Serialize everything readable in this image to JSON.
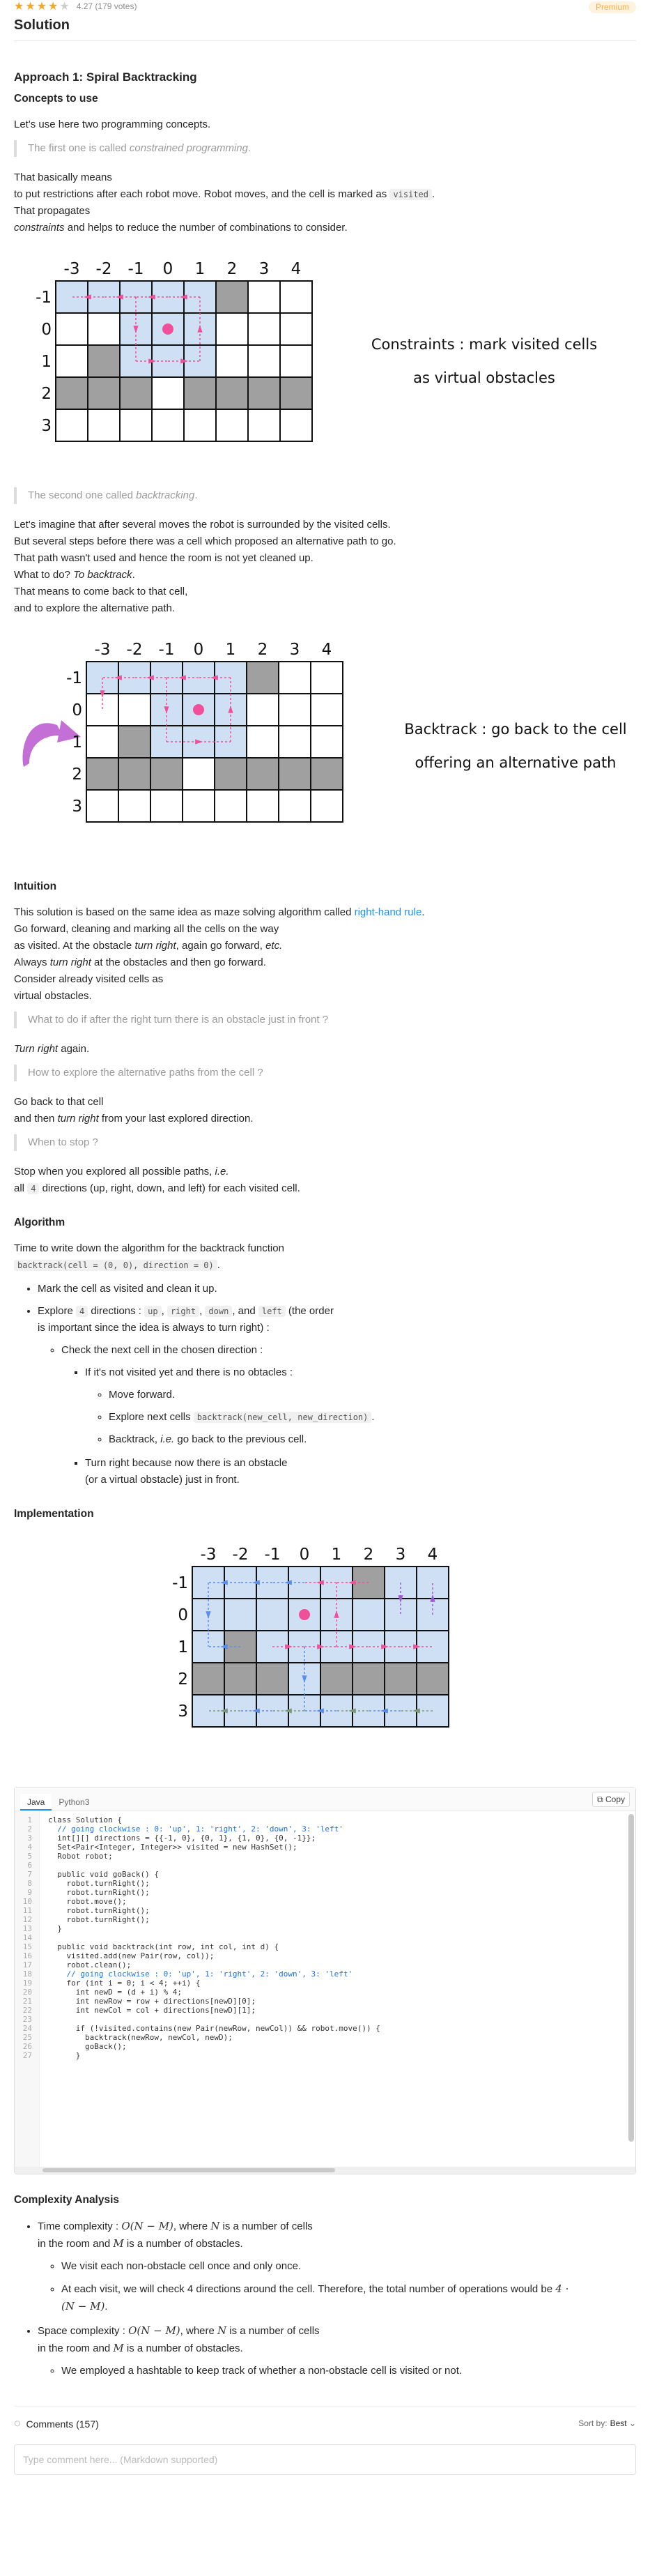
{
  "header": {
    "stars_filled": 4,
    "stars_total": 5,
    "rating_text": "4.27 (179 votes)",
    "premium_label": "Premium",
    "title": "Solution"
  },
  "approach": {
    "title": "Approach 1: Spiral Backtracking",
    "concepts_heading": "Concepts to use",
    "intro": "Let's use here two programming concepts.",
    "quote1_prefix": "The first one is called ",
    "quote1_em": "constrained programming",
    "quote1_suffix": ".",
    "p1_line1": "That basically means",
    "p1_line2_prefix": "to put restrictions after each robot move. Robot moves, and the cell is marked as ",
    "p1_code": "visited",
    "p1_line2_suffix": ".",
    "p1_line3": "That propagates",
    "p1_line4_em": "constraints",
    "p1_line4_suffix": " and helps to reduce the number of combinations to consider.",
    "fig1_caption_line1": "Constraints : mark visited cells",
    "fig1_caption_line2": "as virtual obstacles",
    "quote2_prefix": "The second one called ",
    "quote2_em": "backtracking",
    "quote2_suffix": ".",
    "p2_line1": "Let's imagine that after several moves the robot is surrounded by the visited cells.",
    "p2_line2": "But several steps before there was a cell which proposed an alternative path to go.",
    "p2_line3": "That path wasn't used and hence the room is not yet cleaned up.",
    "p2_line4_prefix": "What to do? ",
    "p2_line4_em": "To backtrack",
    "p2_line4_suffix": ".",
    "p2_line5": "That means to come back to that cell,",
    "p2_line6": "and to explore the alternative path.",
    "fig2_caption_line1": "Backtrack : go back to the cell",
    "fig2_caption_line2": "offering an alternative path"
  },
  "grid": {
    "col_labels": [
      "-3",
      "-2",
      "-1",
      "0",
      "1",
      "2",
      "3",
      "4"
    ],
    "row_labels": [
      "-1",
      "0",
      "1",
      "2",
      "3"
    ]
  },
  "intuition": {
    "heading": "Intuition",
    "p1_prefix": "This solution is based on the same idea as maze solving algorithm called ",
    "p1_link": "right-hand rule",
    "p1_suffix": ".",
    "p2_line1": "Go forward, cleaning and marking all the cells on the way",
    "p2_line2_prefix": "as visited. At the obstacle ",
    "p2_line2_em1": "turn right",
    "p2_line2_mid": ", again go forward, ",
    "p2_line2_em2": "etc.",
    "p2_line3_prefix": "Always ",
    "p2_line3_em": "turn right",
    "p2_line3_suffix": " at the obstacles and then go forward.",
    "p2_line4": "Consider already visited cells as",
    "p2_line5": "virtual obstacles.",
    "q1": "What to do if after the right turn there is an obstacle just in front ?",
    "a1_em": "Turn right",
    "a1_suffix": " again.",
    "q2": "How to explore the alternative paths from the cell ?",
    "a2_line1": "Go back to that cell",
    "a2_line2_prefix": "and then ",
    "a2_line2_em": "turn right",
    "a2_line2_suffix": " from your last explored direction.",
    "q3": "When to stop ?",
    "a3_line1_prefix": "Stop when you explored all possible paths, ",
    "a3_line1_em": "i.e.",
    "a3_line2_prefix": "all ",
    "a3_code": "4",
    "a3_line2_suffix": " directions (up, right, down, and left) for each visited cell."
  },
  "algorithm": {
    "heading": "Algorithm",
    "intro": "Time to write down the algorithm for the backtrack function",
    "signature": "backtrack(cell = (0, 0), direction = 0)",
    "signature_suffix": ".",
    "li1": "Mark the cell as visited and clean it up.",
    "li2_prefix": "Explore ",
    "li2_code_4": "4",
    "li2_mid": " directions : ",
    "li2_up": "up",
    "li2_right": "right",
    "li2_down": "down",
    "li2_and": ", and ",
    "li2_left": "left",
    "li2_suffix1": " (the order",
    "li2_suffix2": "is important since the idea is always to turn right) :",
    "li3": "Check the next cell in the chosen direction :",
    "li4": "If it's not visited yet and there is no obtacles :",
    "li5": "Move forward.",
    "li6_prefix": "Explore next cells ",
    "li6_code": "backtrack(new_cell, new_direction)",
    "li6_suffix": ".",
    "li7_prefix": "Backtrack, ",
    "li7_em": "i.e.",
    "li7_suffix": " go back to the previous cell.",
    "li8_line1": "Turn right because now there is an obstacle",
    "li8_line2": "(or a virtual obstacle) just in front."
  },
  "implementation": {
    "heading": "Implementation",
    "tab_java": "Java",
    "tab_python": "Python3",
    "copy_label": "Copy",
    "code_lines": [
      "class Solution {",
      "  // going clockwise : 0: 'up', 1: 'right', 2: 'down', 3: 'left'",
      "  int[][] directions = {{-1, 0}, {0, 1}, {1, 0}, {0, -1}};",
      "  Set<Pair<Integer, Integer>> visited = new HashSet();",
      "  Robot robot;",
      "",
      "  public void goBack() {",
      "    robot.turnRight();",
      "    robot.turnRight();",
      "    robot.move();",
      "    robot.turnRight();",
      "    robot.turnRight();",
      "  }",
      "",
      "  public void backtrack(int row, int col, int d) {",
      "    visited.add(new Pair(row, col));",
      "    robot.clean();",
      "    // going clockwise : 0: 'up', 1: 'right', 2: 'down', 3: 'left'",
      "    for (int i = 0; i < 4; ++i) {",
      "      int newD = (d + i) % 4;",
      "      int newRow = row + directions[newD][0];",
      "      int newCol = col + directions[newD][1];",
      "",
      "      if (!visited.contains(new Pair(newRow, newCol)) && robot.move()) {",
      "        backtrack(newRow, newCol, newD);",
      "        goBack();",
      "      }"
    ]
  },
  "complexity": {
    "heading": "Complexity Analysis",
    "time_prefix": "Time complexity : ",
    "time_expr": "O(N − M)",
    "time_mid": ", where ",
    "time_N": "N",
    "time_suffix": " is a number of cells",
    "time_line2_prefix": "in the room and ",
    "time_M": "M",
    "time_line2_suffix": " is a number of obstacles.",
    "time_sub1": "We visit each non-obstacle cell once and only once.",
    "time_sub2_prefix": "At each visit, we will check 4 directions around the cell. Therefore, the total number of operations would be ",
    "time_sub2_expr1": "4 ·",
    "time_sub2_expr2": "(N − M)",
    "time_sub2_suffix": ".",
    "space_prefix": "Space complexity : ",
    "space_expr": "O(N − M)",
    "space_mid": ", where ",
    "space_N": "N",
    "space_suffix": " is a number of cells",
    "space_line2_prefix": "in the room and ",
    "space_M": "M",
    "space_line2_suffix": " is a number of obstacles.",
    "space_sub1": "We employed a hashtable to keep track of whether a non-obstacle cell is visited or not."
  },
  "comments": {
    "label": "Comments (157)",
    "sort_label": "Sort by:",
    "sort_value": "Best",
    "placeholder": "Type comment here... (Markdown supported)"
  },
  "colors": {
    "accent": "#1a90ff",
    "star": "#f5a623",
    "visited_cell": "#cfe0f5",
    "obstacle_cell": "#a0a0a0",
    "arrow_pink": "#f0509a",
    "arrow_purple": "#9b59d0"
  }
}
